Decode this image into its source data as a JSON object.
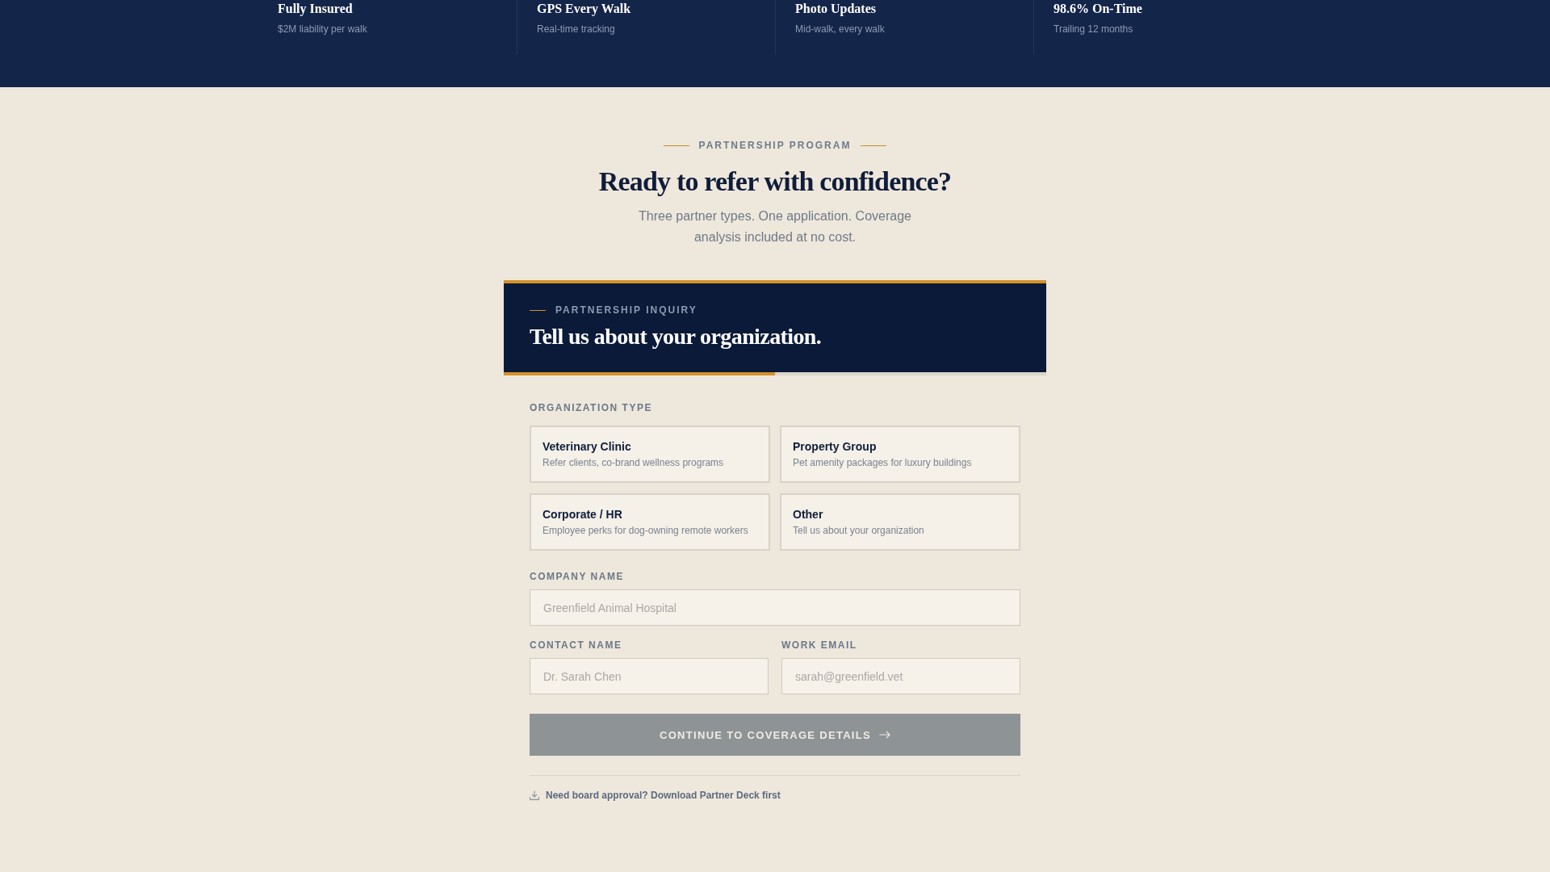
{
  "features": [
    {
      "title": "Fully Insured",
      "subtitle": "$2M liability per walk"
    },
    {
      "title": "GPS Every Walk",
      "subtitle": "Real-time tracking"
    },
    {
      "title": "Photo Updates",
      "subtitle": "Mid-walk, every walk"
    },
    {
      "title": "98.6% On-Time",
      "subtitle": "Trailing 12 months"
    }
  ],
  "section": {
    "eyebrow": "PARTNERSHIP PROGRAM",
    "heading": "Ready to refer with confidence?",
    "subheading": "Three partner types. One application. Coverage analysis included at no cost."
  },
  "form": {
    "eyebrow": "PARTNERSHIP INQUIRY",
    "title": "Tell us about your organization.",
    "progress": {
      "level": 0.5
    },
    "org_type": {
      "label": "ORGANIZATION TYPE",
      "options": [
        {
          "title": "Veterinary Clinic",
          "description": "Refer clients, co-brand wellness programs",
          "selected": false
        },
        {
          "title": "Property Group",
          "description": "Pet amenity packages for luxury buildings",
          "selected": false
        },
        {
          "title": "Corporate / HR",
          "description": "Employee perks for dog-owning remote workers",
          "selected": false
        },
        {
          "title": "Other",
          "description": "Tell us about your organization",
          "selected": false
        }
      ]
    },
    "field_rows": [
      [
        {
          "label": "COMPANY NAME",
          "placeholder": "Greenfield Animal Hospital"
        }
      ],
      [
        {
          "label": "CONTACT NAME",
          "placeholder": "Dr. Sarah Chen"
        },
        {
          "label": "WORK EMAIL",
          "placeholder": "sarah@greenfield.vet"
        }
      ]
    ],
    "submit": {
      "label": "CONTINUE TO COVERAGE DETAILS",
      "disabled": true
    },
    "deck_link": {
      "label": "Need board approval? Download Partner Deck first"
    }
  }
}
